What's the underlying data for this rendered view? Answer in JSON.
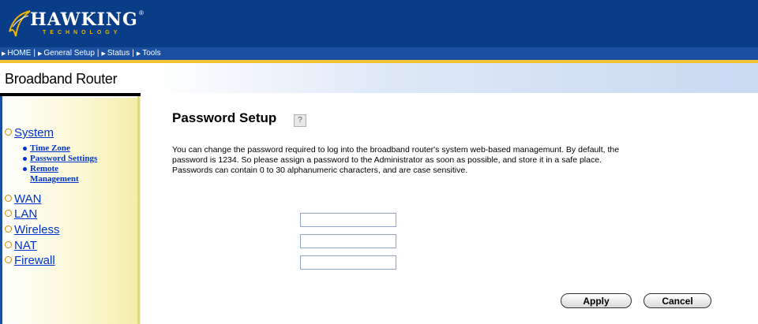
{
  "header": {
    "logo_text": "HAWKING",
    "logo_sub": "TECHNOLOGY",
    "logo_reg": "®"
  },
  "nav": {
    "items": [
      "HOME",
      "General Setup",
      "Status",
      "Tools"
    ]
  },
  "product_title": "Broadband Router",
  "sidebar": {
    "main_items": [
      "System",
      "WAN",
      "LAN",
      "Wireless",
      "NAT",
      "Firewall"
    ],
    "sub_items": [
      "Time Zone",
      "Password Settings",
      "Remote",
      "Management"
    ]
  },
  "main": {
    "title": "Password Setup",
    "help_glyph": "?",
    "description_lines": [
      "You can change the password required to log into the broadband router's system web-based managemunt. By default, the",
      "password is 1234. So please assign a password to the Administrator as soon as possible, and store it in a safe place.",
      "Passwords can contain 0 to 30 alphanumeric characters, and are case sensitive."
    ],
    "fields": [
      {
        "value": ""
      },
      {
        "value": ""
      },
      {
        "value": ""
      }
    ],
    "apply_label": "Apply",
    "cancel_label": "Cancel"
  },
  "colors": {
    "header_bg": "#0a3d87",
    "nav_bg": "#1b4fa0",
    "accent_yellow": "#f2c230",
    "link_blue": "#0033cc"
  }
}
